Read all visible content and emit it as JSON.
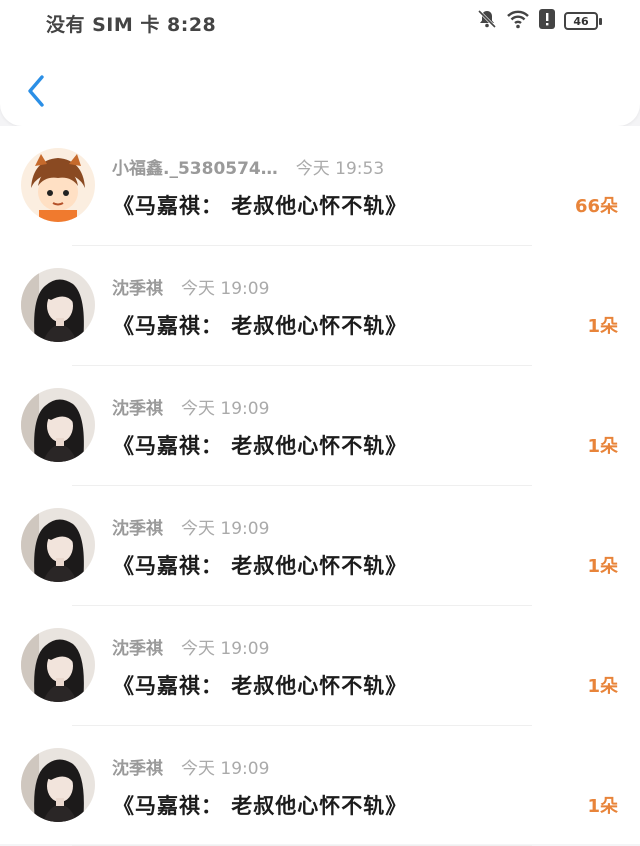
{
  "status_bar": {
    "carrier_time": "没有 SIM 卡 8:28",
    "battery": "46",
    "icons": [
      "bell-off-icon",
      "wifi-icon",
      "alert-icon",
      "battery-icon"
    ]
  },
  "nav": {
    "back_icon": "chevron-left-icon"
  },
  "colors": {
    "accent": "#e8843a",
    "back": "#2b8fe6"
  },
  "items": [
    {
      "name": "小福鑫._5380574…",
      "time": "今天 19:53",
      "title": "《马嘉祺： 老叔他心怀不轨》",
      "count": "66朵",
      "avatar": "cartoon"
    },
    {
      "name": "沈季祺",
      "time": "今天 19:09",
      "title": "《马嘉祺： 老叔他心怀不轨》",
      "count": "1朵",
      "avatar": "photo"
    },
    {
      "name": "沈季祺",
      "time": "今天 19:09",
      "title": "《马嘉祺： 老叔他心怀不轨》",
      "count": "1朵",
      "avatar": "photo"
    },
    {
      "name": "沈季祺",
      "time": "今天 19:09",
      "title": "《马嘉祺： 老叔他心怀不轨》",
      "count": "1朵",
      "avatar": "photo"
    },
    {
      "name": "沈季祺",
      "time": "今天 19:09",
      "title": "《马嘉祺： 老叔他心怀不轨》",
      "count": "1朵",
      "avatar": "photo"
    },
    {
      "name": "沈季祺",
      "time": "今天 19:09",
      "title": "《马嘉祺： 老叔他心怀不轨》",
      "count": "1朵",
      "avatar": "photo"
    }
  ]
}
